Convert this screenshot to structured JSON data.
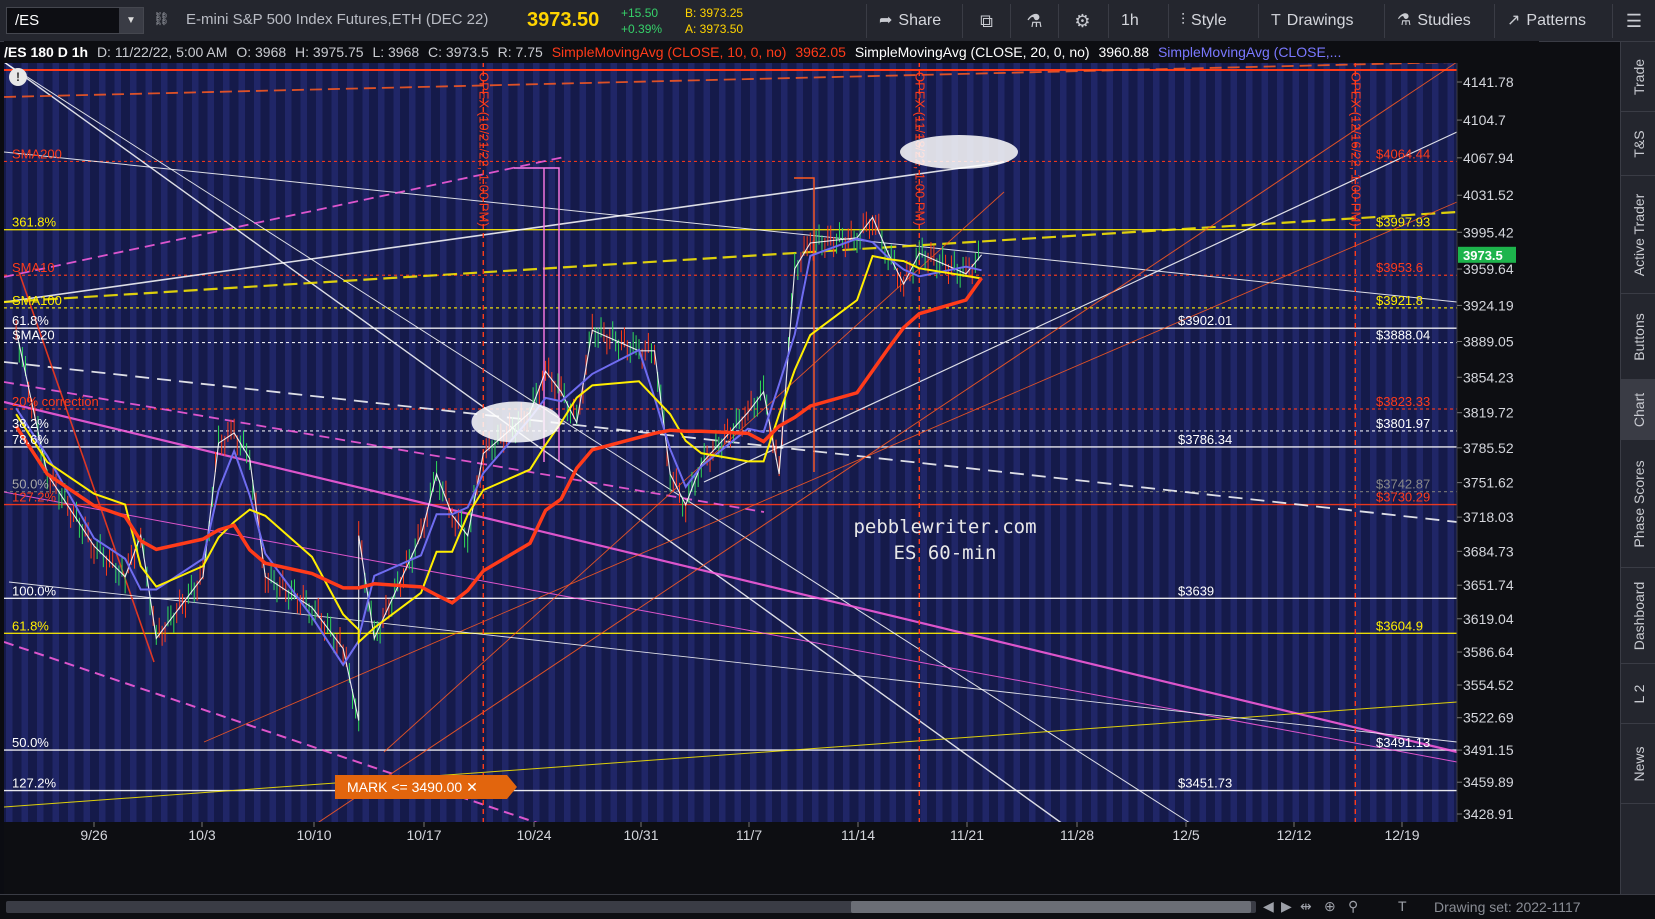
{
  "toolbar": {
    "symbol": "/ES",
    "link_icon": "link-icon",
    "description": "E-mini S&P 500 Index Futures,ETH (DEC 22)",
    "last_price": "3973.50",
    "change": "+15.50",
    "change_pct": "+0.39%",
    "bid": "B: 3973.25",
    "ask": "A: 3973.50",
    "share_label": "Share",
    "interval_label": "1h",
    "style_label": "Style",
    "drawings_label": "Drawings",
    "studies_label": "Studies",
    "patterns_label": "Patterns",
    "colors": {
      "price": "#ffd400",
      "up": "#36d16a"
    }
  },
  "study_bar": {
    "header": "/ES 180 D 1h",
    "date": "D: 11/22/22, 5:00 AM",
    "open": "O: 3968",
    "high": "H: 3975.75",
    "low": "L: 3968",
    "close": "C: 3973.5",
    "range": "R: 7.75",
    "sma10_label": "SimpleMovingAvg (CLOSE, 10, 0, no)",
    "sma10_value": "3962.05",
    "sma20_label": "SimpleMovingAvg (CLOSE, 20, 0, no)",
    "sma20_value": "3960.88",
    "sma100_label": "SimpleMovingAvg (CLOSE,..."
  },
  "chart_data": {
    "type": "candlestick",
    "instrument": "/ES",
    "timeframe": "180 D 1h",
    "ylim": [
      3410,
      4170
    ],
    "y_ticks": [
      4141.78,
      4104.7,
      4067.94,
      4031.52,
      3995.42,
      3959.64,
      3924.19,
      3889.05,
      3854.23,
      3819.72,
      3785.52,
      3751.62,
      3718.03,
      3684.73,
      3651.74,
      3619.04,
      3586.64,
      3554.52,
      3522.69,
      3491.15,
      3459.89,
      3428.91
    ],
    "x_ticks": [
      "9/26",
      "10/3",
      "10/10",
      "10/17",
      "10/24",
      "10/31",
      "11/7",
      "11/14",
      "11/21",
      "11/28",
      "12/5",
      "12/12",
      "12/19"
    ],
    "current_price": "3973.5",
    "price_close_path": [
      [
        "9/21",
        3900
      ],
      [
        "9/23",
        3760
      ],
      [
        "9/26",
        3690
      ],
      [
        "9/28",
        3660
      ],
      [
        "9/29",
        3700
      ],
      [
        "9/30",
        3600
      ],
      [
        "10/3",
        3660
      ],
      [
        "10/4",
        3790
      ],
      [
        "10/5",
        3800
      ],
      [
        "10/6",
        3775
      ],
      [
        "10/7",
        3660
      ],
      [
        "10/10",
        3630
      ],
      [
        "10/12",
        3590
      ],
      [
        "10/13",
        3520
      ],
      [
        "10/13",
        3700
      ],
      [
        "10/14",
        3600
      ],
      [
        "10/17",
        3700
      ],
      [
        "10/18",
        3760
      ],
      [
        "10/19",
        3720
      ],
      [
        "10/20",
        3700
      ],
      [
        "10/21",
        3780
      ],
      [
        "10/24",
        3820
      ],
      [
        "10/25",
        3860
      ],
      [
        "10/26",
        3840
      ],
      [
        "10/27",
        3810
      ],
      [
        "10/28",
        3900
      ],
      [
        "10/31",
        3880
      ],
      [
        "11/1",
        3880
      ],
      [
        "11/2",
        3760
      ],
      [
        "11/3",
        3730
      ],
      [
        "11/4",
        3770
      ],
      [
        "11/7",
        3820
      ],
      [
        "11/8",
        3840
      ],
      [
        "11/9",
        3760
      ],
      [
        "11/10",
        3960
      ],
      [
        "11/11",
        3985
      ],
      [
        "11/14",
        3990
      ],
      [
        "11/15",
        4010
      ],
      [
        "11/16",
        3975
      ],
      [
        "11/17",
        3945
      ],
      [
        "11/18",
        3975
      ],
      [
        "11/21",
        3955
      ],
      [
        "11/22",
        3973.5
      ]
    ],
    "series": [
      {
        "name": "SMA10",
        "color": "#6f6cf0"
      },
      {
        "name": "SMA20",
        "color": "#ffee00"
      },
      {
        "name": "SMA100",
        "color": "#ff3b1a"
      }
    ],
    "levels": [
      {
        "label": "$4064.44",
        "value": 4064.44,
        "color": "#ff3b1a",
        "style": "dotted",
        "left_label": "SMA200"
      },
      {
        "label": "$3997.93",
        "value": 3997.93,
        "color": "#ffee00",
        "style": "solid",
        "left_label": "361.8%"
      },
      {
        "label": "$3953.6",
        "value": 3953.6,
        "color": "#ff3b1a",
        "style": "dotted",
        "left_label": "SMA10"
      },
      {
        "label": "$3921.8",
        "value": 3921.8,
        "color": "#ffee00",
        "style": "dotted",
        "left_label": "SMA100"
      },
      {
        "label": "$3902.01",
        "value": 3902.01,
        "color": "#ffffff",
        "style": "solid",
        "left_label": "61.8%"
      },
      {
        "label": "$3888.04",
        "value": 3888.04,
        "color": "#ffffff",
        "style": "dotted",
        "left_label": "SMA20"
      },
      {
        "label": "$3823.33",
        "value": 3823.33,
        "color": "#ff3b1a",
        "style": "dotted",
        "left_label": "20% correction"
      },
      {
        "label": "$3801.97",
        "value": 3801.97,
        "color": "#ffffff",
        "style": "dotted",
        "left_label": "38.2%"
      },
      {
        "label": "$3786.34",
        "value": 3786.34,
        "color": "#ffffff",
        "style": "solid",
        "left_label": "78.6%"
      },
      {
        "label": "$3742.87",
        "value": 3742.87,
        "color": "#777777",
        "style": "dotted",
        "left_label": "50.0%"
      },
      {
        "label": "$3730.29",
        "value": 3730.29,
        "color": "#ff3b1a",
        "style": "solid",
        "left_label": "127.2%"
      },
      {
        "label": "$3639",
        "value": 3639,
        "color": "#ffffff",
        "style": "solid",
        "left_label": "100.0%"
      },
      {
        "label": "$3604.9",
        "value": 3604.9,
        "color": "#ffee00",
        "style": "solid",
        "left_label": "61.8%"
      },
      {
        "label": "$3491.13",
        "value": 3491.13,
        "color": "#ffffff",
        "style": "solid",
        "left_label": "50.0%"
      },
      {
        "label": "$3451.73",
        "value": 3451.73,
        "color": "#ffffff",
        "style": "solid",
        "left_label": "127.2%"
      }
    ],
    "opex_markers": [
      {
        "label": "OPEX (10/21/22, 1:00 PM)",
        "date": "10/21"
      },
      {
        "label": "OPEX (11/18/22, 1:00 PM)",
        "date": "11/18"
      },
      {
        "label": "OPEX (12/16/22, 1:00 PM)",
        "date": "12/16"
      }
    ],
    "mark_order": "MARK <= 3490.00",
    "watermark": [
      "pebblewriter.com",
      "ES 60-min"
    ]
  },
  "sidebar": {
    "tabs": [
      "Trade",
      "T&S",
      "Active Trader",
      "Buttons",
      "Chart",
      "Phase Scores",
      "Dashboard",
      "L 2",
      "News"
    ],
    "active": "Chart"
  },
  "bottombar": {
    "drawing_set": "Drawing set: 2022-1117"
  }
}
